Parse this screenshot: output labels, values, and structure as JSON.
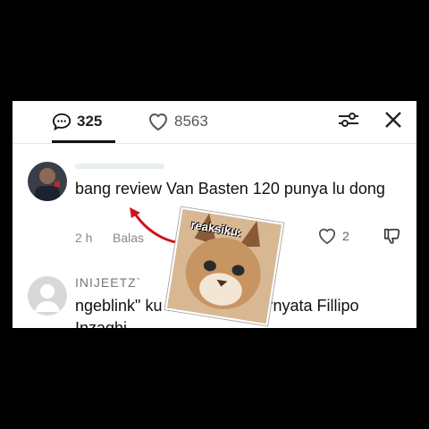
{
  "tabs": {
    "comments_count": "325",
    "likes_count": "8563"
  },
  "comments": [
    {
      "username": "",
      "text": "bang review Van Basten 120 punya lu dong",
      "time": "2 h",
      "reply_label": "Balas",
      "like_count": "2"
    },
    {
      "username": "INIJEETZ`",
      "text": "ngeblink\" ku kira lag... Fi ternyata Fillipo Inzaghi"
    }
  ],
  "sticker": {
    "label": "reaksiku:"
  },
  "icons": {
    "comments": "chat-bubble-icon",
    "likes": "heart-icon",
    "filter": "sliders-icon",
    "close": "close-icon",
    "comment_like": "heart-icon",
    "comment_dislike": "thumbs-down-icon"
  }
}
